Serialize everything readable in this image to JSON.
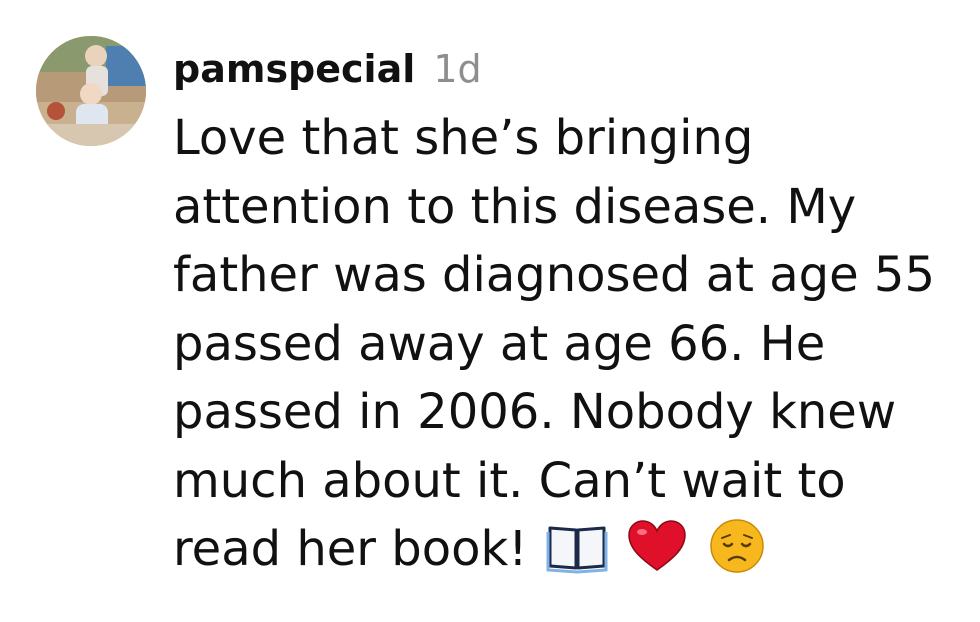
{
  "comment": {
    "username": "pamspecial",
    "timestamp": "1d",
    "text_lines": [
      "Love that she’s bringing",
      "attention to this disease. My",
      "father was diagnosed at age 55",
      "passed away at age 66. He",
      "passed in 2006. Nobody knew",
      "much about it. Can’t wait to",
      "read her book!"
    ],
    "emojis": [
      "open-book-icon",
      "red-heart-icon",
      "disappointed-face-icon"
    ]
  },
  "colors": {
    "text": "#111111",
    "timestamp": "#8e8e8e",
    "heart": "#e0102a",
    "face": "#f7b81e"
  }
}
